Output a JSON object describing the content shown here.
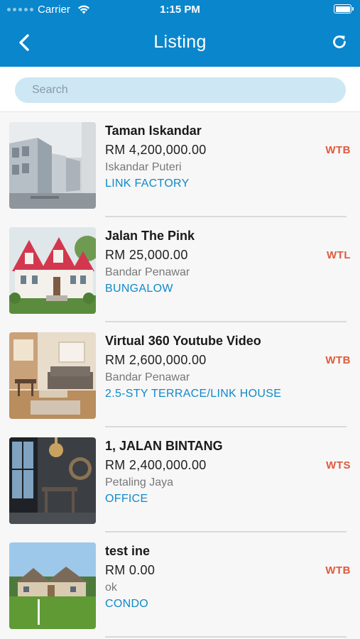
{
  "status_bar": {
    "carrier": "Carrier",
    "time": "1:15 PM"
  },
  "nav": {
    "title": "Listing",
    "back_icon": "chevron-left-icon",
    "refresh_icon": "refresh-icon"
  },
  "search": {
    "placeholder": "Search",
    "value": ""
  },
  "colors": {
    "header": "#0a86cc",
    "search_bg": "#cde7f4",
    "tag": "#e05a3c",
    "type": "#1089c9"
  },
  "listings": [
    {
      "title": "Taman Iskandar",
      "price": "RM 4,200,000.00",
      "location": "Iskandar Puteri",
      "type": "LINK FACTORY",
      "tag": "WTB"
    },
    {
      "title": "Jalan The Pink",
      "price": "RM 25,000.00",
      "location": "Bandar Penawar",
      "type": "BUNGALOW",
      "tag": "WTL"
    },
    {
      "title": "Virtual 360 Youtube Video",
      "price": "RM 2,600,000.00",
      "location": "Bandar Penawar",
      "type": "2.5-STY TERRACE/LINK HOUSE",
      "tag": "WTB"
    },
    {
      "title": "1, JALAN BINTANG",
      "price": "RM 2,400,000.00",
      "location": "Petaling Jaya",
      "type": "OFFICE",
      "tag": "WTS"
    },
    {
      "title": "test ine",
      "price": "RM 0.00",
      "location": "ok",
      "type": "CONDO",
      "tag": "WTB"
    }
  ]
}
